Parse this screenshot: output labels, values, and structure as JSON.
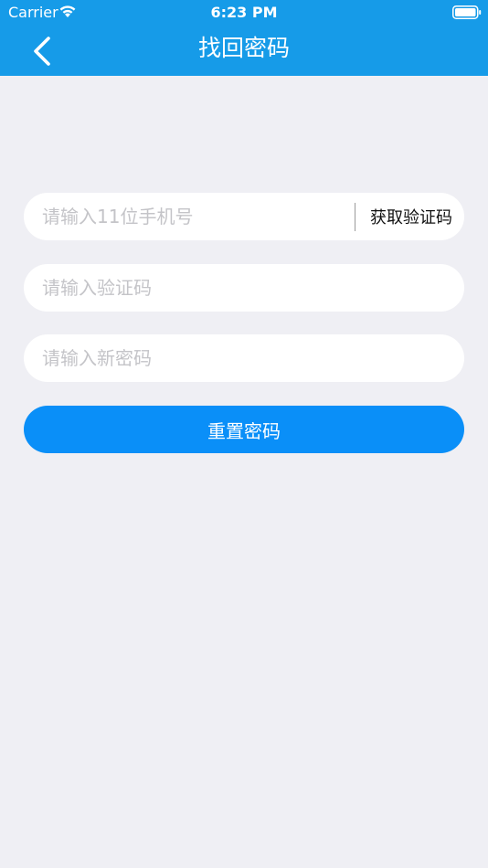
{
  "status_bar": {
    "carrier": "Carrier",
    "time": "6:23 PM"
  },
  "nav": {
    "title": "找回密码",
    "back_icon": "chevron-left-icon"
  },
  "form": {
    "phone": {
      "placeholder": "请输入11位手机号",
      "value": ""
    },
    "get_code_label": "获取验证码",
    "code": {
      "placeholder": "请输入验证码",
      "value": ""
    },
    "new_password": {
      "placeholder": "请输入新密码",
      "value": ""
    },
    "submit_label": "重置密码"
  },
  "colors": {
    "header": "#169be8",
    "background": "#efeff4",
    "primary_button": "#0a8ff8",
    "placeholder": "#c4c4c8"
  }
}
